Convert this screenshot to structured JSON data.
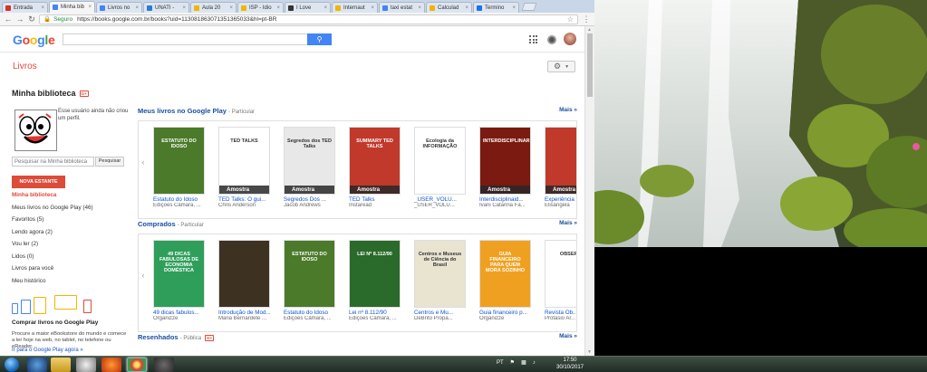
{
  "browser": {
    "tabs": [
      {
        "label": "Entrada",
        "color": "#d93025"
      },
      {
        "label": "Minha bib",
        "color": "#4285f4"
      },
      {
        "label": "Livros no",
        "color": "#4285f4"
      },
      {
        "label": "UNATI -",
        "color": "#2a7bd4"
      },
      {
        "label": "Aula 20",
        "color": "#f4b400"
      },
      {
        "label": "ISP - Idio",
        "color": "#f4b400"
      },
      {
        "label": "I Love",
        "color": "#333333"
      },
      {
        "label": "Internaut",
        "color": "#f4b400"
      },
      {
        "label": "taxi estat",
        "color": "#4285f4"
      },
      {
        "label": "Calculad",
        "color": "#f4b400"
      },
      {
        "label": "Termino",
        "color": "#1a73e8"
      }
    ],
    "active_tab_index": 1,
    "secure_label": "Seguro",
    "url": "https://books.google.com.br/books?uid=113081863071351365033&hl=pt-BR"
  },
  "google": {
    "logo": "Google",
    "logo_colors": [
      "#4285f4",
      "#ea4335",
      "#fbbc05",
      "#4285f4",
      "#34a853",
      "#ea4335"
    ]
  },
  "header": {
    "section": "Livros"
  },
  "sidebar": {
    "library_title": "Minha biblioteca",
    "gplus_label": "G+",
    "profile_note": "Esse usuário ainda não criou um perfil.",
    "search_placeholder": "Pesquisar na Minha biblioteca",
    "search_button": "Pesquisar",
    "new_shelf_button": "NOVA ESTANTE",
    "items": [
      {
        "label": "Minha biblioteca",
        "selected": true
      },
      {
        "label": "Meus livros no Google Play (46)"
      },
      {
        "label": "Favoritos (5)"
      },
      {
        "label": "Lendo agora (2)"
      },
      {
        "label": "Vou ler (2)"
      },
      {
        "label": "Lidos (0)"
      },
      {
        "label": "Livros para você"
      },
      {
        "label": "Meu histórico"
      }
    ],
    "buy_title": "Comprar livros no Google Play",
    "buy_desc": "Procure a maior eBookstore do mundo e comece a ler hoje na web, no tablet, no telefone ou eReader.",
    "buy_link": "Ir para o Google Play agora »"
  },
  "sections": [
    {
      "title": "Meus livros no Google Play",
      "privacy": "- Particular",
      "more": "Mais »",
      "books": [
        {
          "title": "Estatuto do Idoso",
          "author": "Edições Câmara, ...",
          "cover_color": "#4a7a2a",
          "cover_text": "ESTATUTO DO IDOSO",
          "amostra": false
        },
        {
          "title": "TED Talks: O gui...",
          "author": "Chris Anderson",
          "cover_color": "#ffffff",
          "cover_text": "TED TALKS",
          "amostra": true
        },
        {
          "title": "Segredos Dos ...",
          "author": "Jacob Andrews",
          "cover_color": "#e8e8e8",
          "cover_text": "Segredos dos TED Talks",
          "amostra": true
        },
        {
          "title": "TED Talks",
          "author": "Instaread",
          "cover_color": "#c0392b",
          "cover_text": "SUMMARY TED TALKS",
          "amostra": true
        },
        {
          "title": "_USER_VOLU...",
          "author": "_USER_VOLU...",
          "cover_color": "#ffffff",
          "cover_text": "Ecologia da INFORMAÇÃO",
          "amostra": false
        },
        {
          "title": "Interdisciplinaid...",
          "author": "Ivani Catarina Fa...",
          "cover_color": "#7a1a10",
          "cover_text": "INTERDISCIPLINARIDADE",
          "amostra": true
        },
        {
          "title": "Experiência",
          "author": "Elisângela",
          "cover_color": "#c0392b",
          "cover_text": "",
          "amostra": true
        }
      ]
    },
    {
      "title": "Comprados",
      "privacy": "- Particular",
      "more": "Mais »",
      "books": [
        {
          "title": "49 dicas fabulos...",
          "author": "Organizze",
          "cover_color": "#2e9e5a",
          "cover_text": "49 DICAS FABULOSAS DE ECONOMIA DOMÉSTICA",
          "amostra": false
        },
        {
          "title": "Introdução de Mod...",
          "author": "Maria Bernardete ...",
          "cover_color": "#3d3122",
          "cover_text": "",
          "amostra": false
        },
        {
          "title": "Estatuto do Idoso",
          "author": "Edições Câmara, ...",
          "cover_color": "#4a7a2a",
          "cover_text": "ESTATUTO DO IDOSO",
          "amostra": false
        },
        {
          "title": "Lei nº 8.112/90",
          "author": "Edições Câmara, ...",
          "cover_color": "#2a6a2a",
          "cover_text": "LEI Nº 8.112/90",
          "amostra": false
        },
        {
          "title": "Centros e Mu...",
          "author": "DeBrito Propa...",
          "cover_color": "#e8e4d0",
          "cover_text": "Centros e Museus de Ciência do Brasil",
          "amostra": false
        },
        {
          "title": "Guia financeiro p...",
          "author": "Organizze",
          "cover_color": "#f0a020",
          "cover_text": "GUIA FINANCEIRO PARA QUEM MORA SOZINHO",
          "amostra": false
        },
        {
          "title": "Revista Ob...",
          "author": "Protásio Ar...",
          "cover_color": "#ffffff",
          "cover_text": "OBSERV",
          "amostra": false
        }
      ]
    },
    {
      "title": "Resenhados",
      "privacy": "- Pública",
      "more": "Mais »",
      "books": []
    }
  ],
  "taskbar": {
    "lang": "PT",
    "time": "17:50",
    "date": "30/10/2017"
  }
}
